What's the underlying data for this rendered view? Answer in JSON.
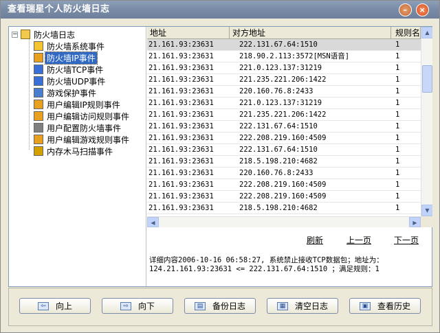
{
  "window": {
    "title": "查看瑞星个人防火墙日志",
    "minimize_glyph": "–",
    "close_glyph": "×"
  },
  "tree": {
    "root_label": "防火墙日志",
    "items": [
      {
        "label": "防火墙系统事件",
        "icon": "system-event-icon",
        "color": "#f4c430"
      },
      {
        "label": "防火墙IP事件",
        "icon": "ip-event-icon",
        "color": "#e8a020",
        "selected": true
      },
      {
        "label": "防火墙TCP事件",
        "icon": "tcp-event-icon",
        "color": "#3a6fd8"
      },
      {
        "label": "防火墙UDP事件",
        "icon": "udp-event-icon",
        "color": "#3a6fd8"
      },
      {
        "label": "游戏保护事件",
        "icon": "game-protect-icon",
        "color": "#4a7fcf"
      },
      {
        "label": "用户编辑IP规则事件",
        "icon": "edit-ip-rule-icon",
        "color": "#e8a020"
      },
      {
        "label": "用户编辑访问规则事件",
        "icon": "edit-access-rule-icon",
        "color": "#e8a020"
      },
      {
        "label": "用户配置防火墙事件",
        "icon": "config-firewall-icon",
        "color": "#808080"
      },
      {
        "label": "用户编辑游戏规则事件",
        "icon": "edit-game-rule-icon",
        "color": "#e8a020"
      },
      {
        "label": "内存木马扫描事件",
        "icon": "memory-trojan-scan-icon",
        "color": "#d4a000"
      }
    ]
  },
  "table": {
    "columns": [
      "地址",
      "对方地址",
      "规则名称"
    ],
    "rows": [
      [
        "21.161.93:23631",
        "222.131.67.64:1510",
        "1"
      ],
      [
        "21.161.93:23631",
        "218.90.2.113:3572[MSN语音]",
        "1"
      ],
      [
        "21.161.93:23631",
        "221.0.123.137:31219",
        "1"
      ],
      [
        "21.161.93:23631",
        "221.235.221.206:1422",
        "1"
      ],
      [
        "21.161.93:23631",
        "220.160.76.8:2433",
        "1"
      ],
      [
        "21.161.93:23631",
        "221.0.123.137:31219",
        "1"
      ],
      [
        "21.161.93:23631",
        "221.235.221.206:1422",
        "1"
      ],
      [
        "21.161.93:23631",
        "222.131.67.64:1510",
        "1"
      ],
      [
        "21.161.93:23631",
        "222.208.219.160:4509",
        "1"
      ],
      [
        "21.161.93:23631",
        "222.131.67.64:1510",
        "1"
      ],
      [
        "21.161.93:23631",
        "218.5.198.210:4682",
        "1"
      ],
      [
        "21.161.93:23631",
        "220.160.76.8:2433",
        "1"
      ],
      [
        "21.161.93:23631",
        "222.208.219.160:4509",
        "1"
      ],
      [
        "21.161.93:23631",
        "222.208.219.160:4509",
        "1"
      ],
      [
        "21.161.93:23631",
        "218.5.198.210:4682",
        "1"
      ]
    ]
  },
  "nav": {
    "refresh": "刷新",
    "prev_page": "上一页",
    "next_page": "下一页"
  },
  "detail": {
    "text": "详细内容2006-10-16 06:58:27, 系统禁止接收TCP数据包；地址为：\n124.21.161.93:23631 <= 222.131.67.64:1510 ；满足规则：1"
  },
  "buttons": {
    "up": "向上",
    "down": "向下",
    "backup": "备份日志",
    "clear": "清空日志",
    "history": "查看历史"
  },
  "scroll_glyphs": {
    "up": "▲",
    "down": "▼",
    "left": "◀",
    "right": "▶"
  }
}
